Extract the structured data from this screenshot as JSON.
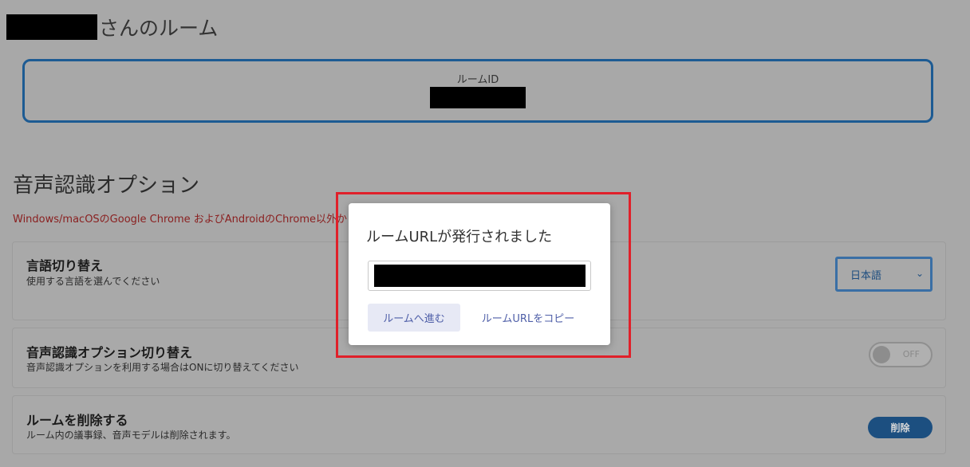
{
  "room": {
    "title_suffix": "さんのルーム",
    "id_label": "ルームID"
  },
  "speech_options": {
    "title": "音声認識オプション",
    "warning": "Windows/macOSのGoogle Chrome およびAndroidのChrome以外か",
    "language": {
      "title": "言語切り替え",
      "desc": "使用する言語を選んでください",
      "selected": "日本語",
      "chevron": "chevron-down-icon"
    },
    "toggle": {
      "title": "音声認識オプション切り替え",
      "desc": "音声認識オプションを利用する場合はONに切り替えてください",
      "state": "OFF"
    },
    "delete": {
      "title": "ルームを削除する",
      "desc": "ルーム内の議事録、音声モデルは削除されます。",
      "button": "削除"
    }
  },
  "modal": {
    "title": "ルームURLが発行されました",
    "enter_button": "ルームへ進む",
    "copy_link": "ルームURLをコピー"
  },
  "colors": {
    "accent": "#1d5b93",
    "highlight": "#e0202a",
    "modal_button_bg": "#e7e9f5"
  }
}
